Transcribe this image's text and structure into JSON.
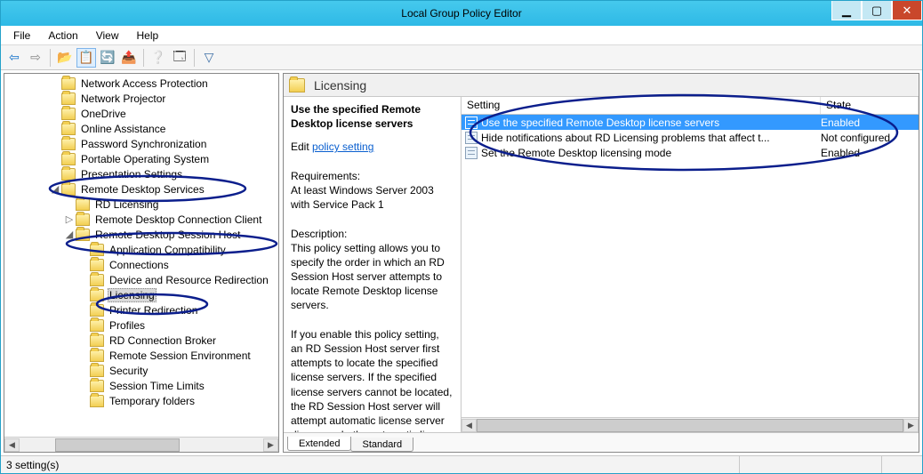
{
  "window": {
    "title": "Local Group Policy Editor"
  },
  "menu": {
    "file": "File",
    "action": "Action",
    "view": "View",
    "help": "Help"
  },
  "toolbar_icons": {
    "back": "⇦",
    "forward": "⇨",
    "up": "📂",
    "props": "📋",
    "refresh": "🔄",
    "export": "📤",
    "help": "❔",
    "showhide": "🗔",
    "filter": "▽"
  },
  "tree": [
    {
      "indent": 3,
      "label": "Network Access Protection"
    },
    {
      "indent": 3,
      "label": "Network Projector"
    },
    {
      "indent": 3,
      "label": "OneDrive"
    },
    {
      "indent": 3,
      "label": "Online Assistance"
    },
    {
      "indent": 3,
      "label": "Password Synchronization"
    },
    {
      "indent": 3,
      "label": "Portable Operating System"
    },
    {
      "indent": 3,
      "label": "Presentation Settings"
    },
    {
      "indent": 3,
      "label": "Remote Desktop Services",
      "twisty": "◢"
    },
    {
      "indent": 4,
      "label": "RD Licensing"
    },
    {
      "indent": 4,
      "label": "Remote Desktop Connection Client",
      "twisty": "▷"
    },
    {
      "indent": 4,
      "label": "Remote Desktop Session Host",
      "twisty": "◢"
    },
    {
      "indent": 5,
      "label": "Application Compatibility"
    },
    {
      "indent": 5,
      "label": "Connections"
    },
    {
      "indent": 5,
      "label": "Device and Resource Redirection"
    },
    {
      "indent": 5,
      "label": "Licensing",
      "selected": true
    },
    {
      "indent": 5,
      "label": "Printer Redirection"
    },
    {
      "indent": 5,
      "label": "Profiles"
    },
    {
      "indent": 5,
      "label": "RD Connection Broker"
    },
    {
      "indent": 5,
      "label": "Remote Session Environment"
    },
    {
      "indent": 5,
      "label": "Security"
    },
    {
      "indent": 5,
      "label": "Session Time Limits"
    },
    {
      "indent": 5,
      "label": "Temporary folders"
    }
  ],
  "detail": {
    "heading": "Licensing",
    "selected_policy": "Use the specified Remote Desktop license servers",
    "edit_label": "Edit",
    "edit_link": "policy setting",
    "req_label": "Requirements:",
    "req_text": "At least Windows Server 2003 with Service Pack 1",
    "desc_label": "Description:",
    "desc_text1": "This policy setting allows you to specify the order in which an RD Session Host server attempts to locate Remote Desktop license servers.",
    "desc_text2": "If you enable this policy setting, an RD Session Host server first attempts to locate the specified license servers. If the specified license servers cannot be located, the RD Session Host server will attempt automatic license server discovery. In the automatic license"
  },
  "columns": {
    "setting": "Setting",
    "state": "State"
  },
  "rows": [
    {
      "setting": "Use the specified Remote Desktop license servers",
      "state": "Enabled",
      "selected": true
    },
    {
      "setting": "Hide notifications about RD Licensing problems that affect t...",
      "state": "Not configured"
    },
    {
      "setting": "Set the Remote Desktop licensing mode",
      "state": "Enabled"
    }
  ],
  "tabs": {
    "extended": "Extended",
    "standard": "Standard"
  },
  "status": "3 setting(s)"
}
